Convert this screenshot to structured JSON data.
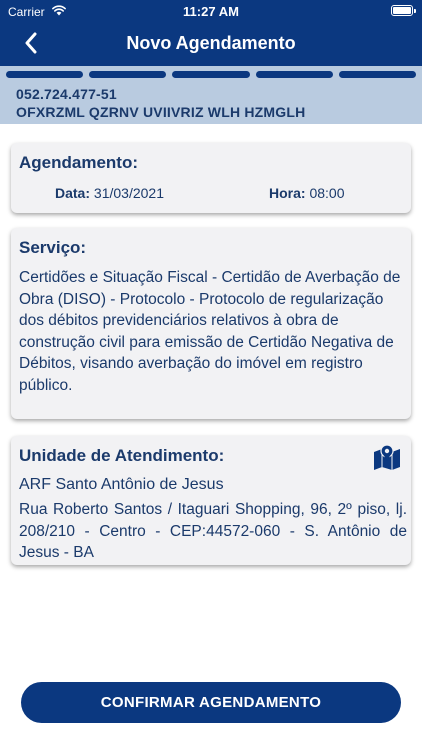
{
  "status_bar": {
    "carrier": "Carrier",
    "time": "11:27 AM"
  },
  "header": {
    "title": "Novo Agendamento",
    "back_icon": "chevron-left-icon"
  },
  "progress": {
    "steps_total": 5,
    "steps_completed": 5
  },
  "citizen": {
    "document": "052.724.477-51",
    "name": "OFXRZML QZRNV UVIIVRIZ WLH HZMGLH"
  },
  "appointment": {
    "title": "Agendamento:",
    "date_label": "Data:",
    "date_value": "31/03/2021",
    "time_label": "Hora:",
    "time_value": "08:00"
  },
  "service": {
    "title": "Serviço:",
    "description": "Certidões e Situação Fiscal - Certidão de Averbação de Obra (DISO) - Protocolo  - Protocolo de regularização dos débitos previdenciários relativos à obra de construção civil para emissão de Certidão Negativa de Débitos, visando averbação do imóvel em registro público."
  },
  "unit": {
    "title": "Unidade de Atendimento:",
    "name": "ARF Santo Antônio de Jesus",
    "address": "Rua Roberto Santos / Itaguari Shopping, 96, 2º piso, lj. 208/210 - Centro - CEP:44572-060 - S. Antônio de Jesus - BA",
    "map_icon": "map-marker-icon"
  },
  "actions": {
    "confirm_label": "CONFIRMAR AGENDAMENTO"
  },
  "colors": {
    "primary": "#0b3880",
    "strip": "#b9cbe0",
    "text": "#1b3a6b",
    "card": "#f2f2f4"
  }
}
